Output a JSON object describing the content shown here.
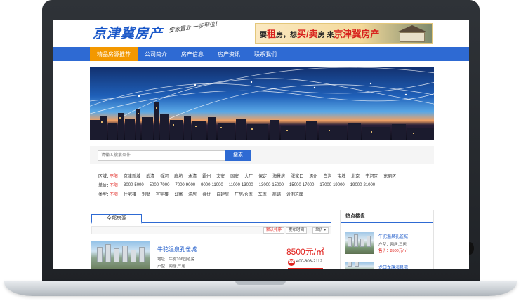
{
  "header": {
    "logo": "京津冀房产",
    "slogan": "安家置业  一步到位！",
    "banner_text_prefix": "要",
    "banner_rent": "租",
    "banner_mid": "房，想",
    "banner_buy": "买/卖",
    "banner_mid2": "房 来",
    "banner_brand": "京津冀房产"
  },
  "nav": {
    "items": [
      "精品房源推荐",
      "公司简介",
      "房产信息",
      "房产资讯",
      "联系我们"
    ],
    "active_index": 0
  },
  "search": {
    "placeholder": "请输入搜索条件",
    "button": "搜索"
  },
  "filters": {
    "district": {
      "label": "区域：",
      "options": [
        "不限",
        "京津新城",
        "武清",
        "香河",
        "廊坊",
        "永清",
        "霸州",
        "文安",
        "固安",
        "大厂",
        "保定",
        "海景房",
        "张家口",
        "涿州",
        "白沟",
        "宝坻",
        "北京",
        "宁河区",
        "东丽区"
      ]
    },
    "price": {
      "label": "单价：",
      "options": [
        "不限",
        "3000-5000",
        "5000-7000",
        "7000-9000",
        "9000-11000",
        "11000-13000",
        "13000-15000",
        "15000-17000",
        "17000-19000",
        "19000-21000"
      ]
    },
    "type": {
      "label": "类型：",
      "options": [
        "不限",
        "住宅楼",
        "别墅",
        "写字楼",
        "公寓",
        "洋房",
        "叠拼",
        "自建房",
        "厂房/仓库",
        "车库",
        "商铺",
        "设例这面"
      ]
    }
  },
  "listings": {
    "tab_label": "全部房源",
    "sort": [
      "默认排序",
      "发布时间",
      "单价"
    ],
    "item": {
      "name": "牛驼温泉孔雀城",
      "address": "地址：牛驼106国道旁",
      "unit_type": "户型：两居,三居",
      "price": "8500元/㎡",
      "phone": "400-803-2112"
    }
  },
  "sidebar": {
    "title": "热点楼盘",
    "items": [
      {
        "name": "牛驼温泉孔雀城",
        "unit_type": "户型：两居,三居",
        "price": "售价：8500元/㎡"
      },
      {
        "name": "龙口龙旗海泉湾"
      }
    ]
  },
  "colors": {
    "brand_blue": "#2e6ad3",
    "nav_active": "#f39800",
    "price_red": "#e0201b"
  }
}
